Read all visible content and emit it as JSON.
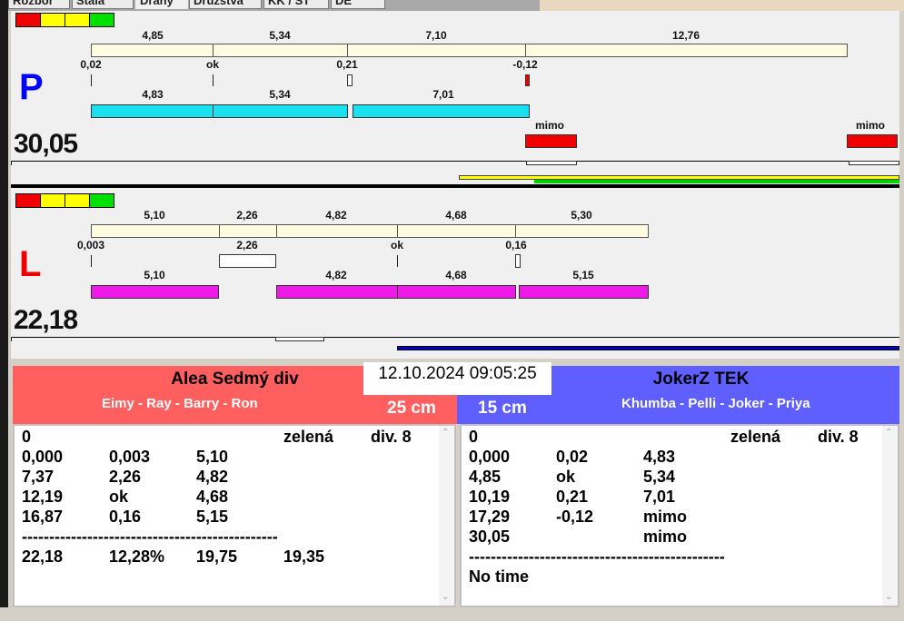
{
  "tabs": [
    "Rozbor",
    "Stála",
    "Dráhy",
    "Družstva",
    "KK / ST",
    "DE"
  ],
  "colors": {
    "red": "#f00000",
    "yellow": "#ffff00",
    "green": "#00e000",
    "cyan": "#19e1f0",
    "magenta": "#f01ae8",
    "team_left": "#ff5f5f",
    "team_right": "#5f5fff"
  },
  "lane_p": {
    "letter": "P",
    "total": "30,05",
    "top_labels": [
      "4,85",
      "5,34",
      "7,10",
      "12,76"
    ],
    "mid_labels": [
      "0,02",
      "ok",
      "0,21",
      "-0,12"
    ],
    "bottom_labels": [
      "4,83",
      "5,34",
      "7,01"
    ],
    "mimo": [
      "mimo",
      "mimo"
    ]
  },
  "lane_l": {
    "letter": "L",
    "total": "22,18",
    "top_labels": [
      "5,10",
      "2,26",
      "4,82",
      "4,68",
      "5,30"
    ],
    "mid_labels": [
      "0,003",
      "2,26",
      "ok",
      "0,16"
    ],
    "bottom_labels": [
      "5,10",
      "4,82",
      "4,68",
      "5,15"
    ]
  },
  "datetime": "12.10.2024 09:05:25",
  "left_team": {
    "name": "Alea Sedmý div",
    "players": "Eimy - Ray - Barry - Ron",
    "distance": "25 cm",
    "rows": [
      [
        "0",
        "",
        "",
        "zelená",
        "div. 8"
      ],
      [
        "0,000",
        "0,003",
        "5,10",
        "",
        ""
      ],
      [
        "7,37",
        "2,26",
        "4,82",
        "",
        ""
      ],
      [
        "12,19",
        "ok",
        "4,68",
        "",
        ""
      ],
      [
        "16,87",
        "0,16",
        "5,15",
        "",
        ""
      ],
      [
        "-----------------------------------------------",
        "",
        "",
        "",
        ""
      ],
      [
        "22,18",
        "12,28%",
        "19,75",
        "19,35",
        ""
      ]
    ]
  },
  "right_team": {
    "name": "JokerZ TEK",
    "players": "Khumba - Pelli - Joker - Priya",
    "distance": "15 cm",
    "rows": [
      [
        "0",
        "",
        "",
        "zelená",
        "div. 8"
      ],
      [
        "0,000",
        "0,02",
        "4,83",
        "",
        ""
      ],
      [
        "4,85",
        "ok",
        "5,34",
        "",
        ""
      ],
      [
        "10,19",
        "0,21",
        "7,01",
        "",
        ""
      ],
      [
        "17,29",
        "-0,12",
        "mimo",
        "",
        ""
      ],
      [
        "30,05",
        "",
        "mimo",
        "",
        ""
      ],
      [
        "-----------------------------------------------",
        "",
        "",
        "",
        ""
      ],
      [
        "No time",
        "",
        "",
        "",
        ""
      ]
    ]
  }
}
